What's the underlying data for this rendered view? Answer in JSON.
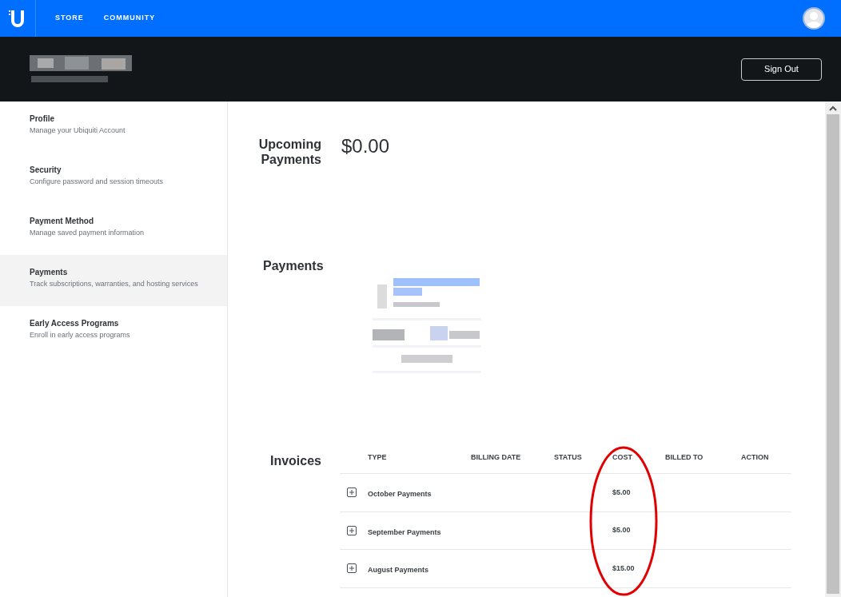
{
  "top_nav": {
    "items": [
      {
        "label": "STORE"
      },
      {
        "label": "COMMUNITY"
      }
    ]
  },
  "header": {
    "sign_out": "Sign Out"
  },
  "sidebar": {
    "items": [
      {
        "title": "Profile",
        "subtitle": "Manage your Ubiquiti Account",
        "selected": false
      },
      {
        "title": "Security",
        "subtitle": "Configure password and session timeouts",
        "selected": false
      },
      {
        "title": "Payment Method",
        "subtitle": "Manage saved payment information",
        "selected": false
      },
      {
        "title": "Payments",
        "subtitle": "Track subscriptions, warranties, and hosting services",
        "selected": true
      },
      {
        "title": "Early Access Programs",
        "subtitle": "Enroll in early access programs",
        "selected": false
      }
    ]
  },
  "upcoming": {
    "label": "Upcoming Payments",
    "amount": "$0.00"
  },
  "payments": {
    "label": "Payments"
  },
  "invoices": {
    "label": "Invoices",
    "columns": [
      "TYPE",
      "BILLING DATE",
      "STATUS",
      "COST",
      "BILLED TO",
      "ACTION"
    ],
    "rows": [
      {
        "type": "October Payments",
        "cost": "$5.00",
        "expanded": false
      },
      {
        "type": "September Payments",
        "cost": "$5.00",
        "expanded": false
      },
      {
        "type": "August Payments",
        "cost": "$15.00",
        "expanded": false
      }
    ]
  }
}
